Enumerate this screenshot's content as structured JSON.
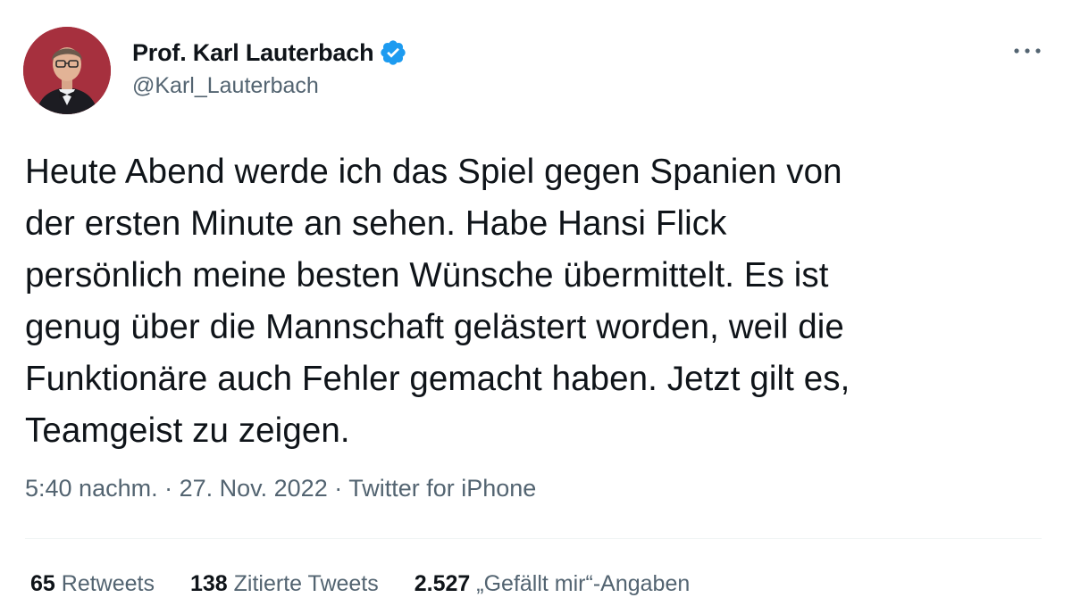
{
  "author": {
    "display_name": "Prof. Karl Lauterbach",
    "handle": "@Karl_Lauterbach",
    "verified": true
  },
  "icons": {
    "verified": "verified-badge-icon",
    "more": "more-icon"
  },
  "colors": {
    "verified": "#1d9bf0",
    "text_primary": "#0f1419",
    "text_secondary": "#536471",
    "avatar_background": "#a82d3b"
  },
  "tweet": {
    "lines": [
      "Heute Abend werde ich das Spiel gegen Spanien von",
      "der ersten Minute an sehen. Habe Hansi Flick",
      "persönlich meine besten Wünsche übermittelt. Es ist",
      "genug über die Mannschaft gelästert worden, weil die",
      "Funktionäre auch Fehler gemacht haben. Jetzt gilt es,",
      "Teamgeist zu zeigen."
    ]
  },
  "meta": {
    "time": "5:40 nachm.",
    "separator": " · ",
    "date": "27. Nov. 2022",
    "source": "Twitter for iPhone"
  },
  "stats": {
    "retweets_count": "65",
    "retweets_label": "Retweets",
    "quotes_count": "138",
    "quotes_label": "Zitierte Tweets",
    "likes_count": "2.527",
    "likes_label": "„Gefällt mir“-Angaben"
  }
}
